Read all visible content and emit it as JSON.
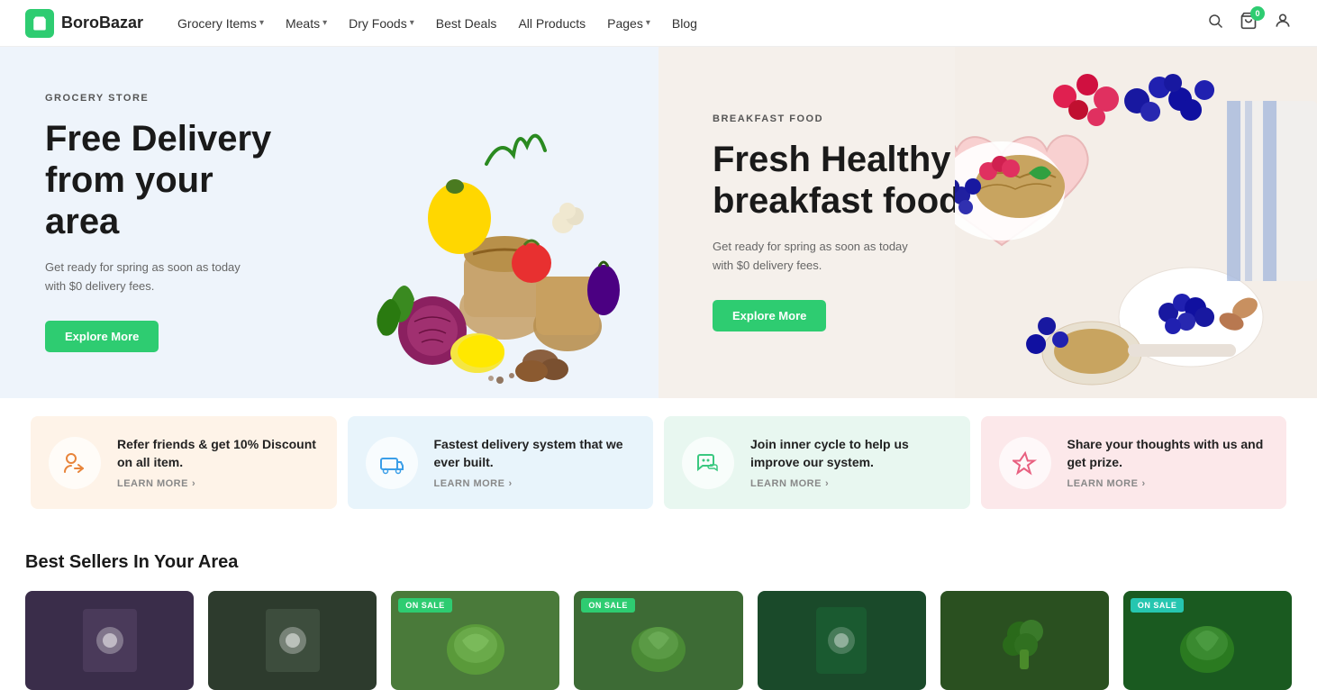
{
  "brand": {
    "name": "BoroBazar",
    "logo_alt": "BoroBazar shopping bag logo"
  },
  "nav": {
    "items": [
      {
        "label": "Grocery Items",
        "has_dropdown": true
      },
      {
        "label": "Meats",
        "has_dropdown": true
      },
      {
        "label": "Dry Foods",
        "has_dropdown": true
      },
      {
        "label": "Best Deals",
        "has_dropdown": false
      },
      {
        "label": "All Products",
        "has_dropdown": false
      },
      {
        "label": "Pages",
        "has_dropdown": true
      },
      {
        "label": "Blog",
        "has_dropdown": false
      }
    ],
    "cart_count": "0"
  },
  "hero_left": {
    "tag": "GROCERY STORE",
    "title": "Free Delivery from your area",
    "desc": "Get ready for spring as soon as today with $0 delivery fees.",
    "btn_label": "Explore More"
  },
  "hero_right": {
    "tag": "BREAKFAST FOOD",
    "title": "Fresh Healthy breakfast food",
    "desc": "Get ready for spring as soon as today with $0 delivery fees.",
    "btn_label": "Explore More"
  },
  "info_cards": [
    {
      "id": "refer",
      "icon": "person-arrow-icon",
      "title": "Refer friends & get 10% Discount on all item.",
      "learn_label": "LEARN MORE"
    },
    {
      "id": "delivery",
      "icon": "delivery-truck-icon",
      "title": "Fastest delivery system that we ever built.",
      "learn_label": "LEARN MORE"
    },
    {
      "id": "feedback",
      "icon": "chat-bubble-icon",
      "title": "Join inner cycle to help us improve our system.",
      "learn_label": "LEARN MORE"
    },
    {
      "id": "prize",
      "icon": "star-icon",
      "title": "Share your thoughts with us and get prize.",
      "learn_label": "LEARN MORE"
    }
  ],
  "best_sellers": {
    "title": "Best Sellers In Your Area",
    "products": [
      {
        "id": 1,
        "on_sale": false,
        "color_class": "prod-1"
      },
      {
        "id": 2,
        "on_sale": false,
        "color_class": "prod-2"
      },
      {
        "id": 3,
        "on_sale": true,
        "badge_color": "green",
        "color_class": "prod-3"
      },
      {
        "id": 4,
        "on_sale": true,
        "badge_color": "green",
        "color_class": "prod-4"
      },
      {
        "id": 5,
        "on_sale": false,
        "color_class": "prod-5"
      },
      {
        "id": 6,
        "on_sale": false,
        "color_class": "prod-6"
      },
      {
        "id": 7,
        "on_sale": true,
        "badge_color": "teal",
        "color_class": "prod-7"
      }
    ],
    "on_sale_label": "ON SALE"
  }
}
